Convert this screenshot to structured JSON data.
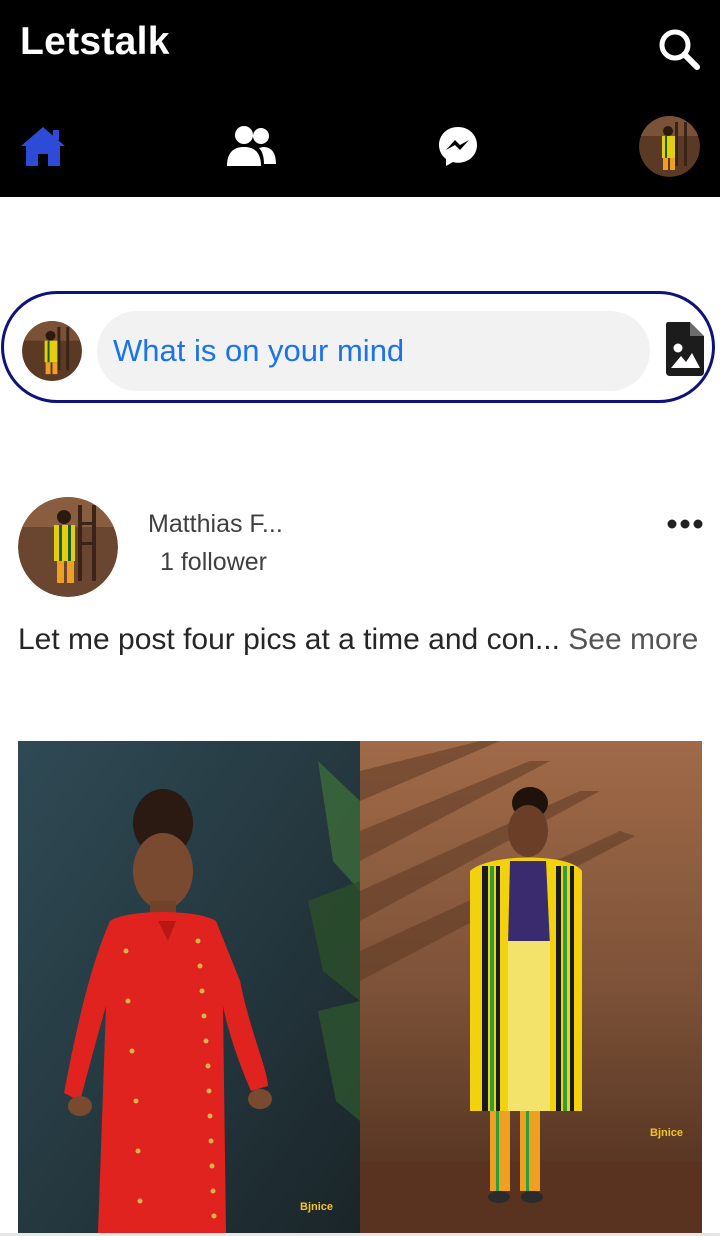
{
  "app": {
    "title": "Letstalk"
  },
  "composer": {
    "placeholder": "What is on your mind"
  },
  "post": {
    "author": "Matthias F...",
    "followers": "1 follower",
    "text": "Let me post four pics at a time and con...",
    "see_more": "See more",
    "watermarks": [
      "Bjnice",
      "Bjnice"
    ]
  },
  "icons": {
    "search": "search-icon",
    "home": "home-icon",
    "friends": "friends-icon",
    "messenger": "messenger-icon",
    "add_photo": "image-file-icon",
    "more": "more-horizontal-icon"
  },
  "colors": {
    "topbar": "#000000",
    "active_nav": "#2d4bd6",
    "composer_border": "#10127a",
    "placeholder": "#1a73e8"
  }
}
